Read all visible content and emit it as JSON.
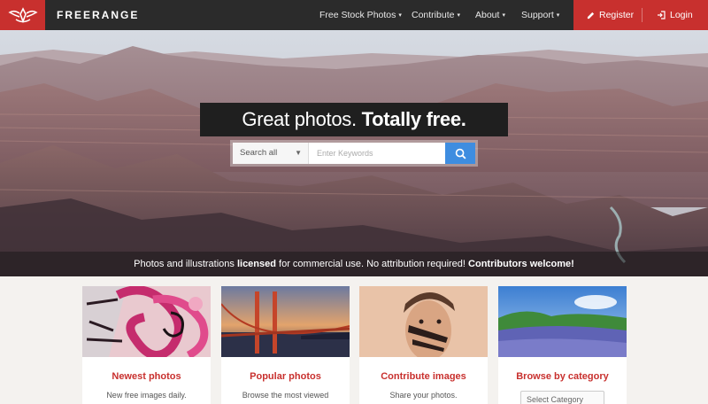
{
  "brand": {
    "name": "FREERANGE",
    "logo_icon": "freerange-logo-icon"
  },
  "nav": {
    "items": [
      {
        "label": "Free Stock Photos"
      },
      {
        "label": "Contribute"
      },
      {
        "label": "About"
      },
      {
        "label": "Support"
      }
    ],
    "caret": "▾"
  },
  "account": {
    "register_label": "Register",
    "login_label": "Login"
  },
  "hero": {
    "headline_regular": "Great photos.",
    "headline_bold": "Totally free.",
    "search": {
      "scope": "Search all",
      "placeholder": "Enter Keywords"
    },
    "tagline": {
      "part1": "Photos and illustrations ",
      "bold1": "licensed",
      "part2": " for commercial use. No attribution required! ",
      "bold2": "Contributors welcome!"
    }
  },
  "cards": [
    {
      "title": "Newest photos",
      "desc": "New free images daily."
    },
    {
      "title": "Popular photos",
      "desc": "Browse the most viewed"
    },
    {
      "title": "Contribute images",
      "desc": "Share your photos."
    },
    {
      "title": "Browse by category",
      "select": "Select Category"
    }
  ],
  "colors": {
    "accent": "#c8302e",
    "topbar": "#2b2b2b",
    "search_button": "#3e8de0"
  }
}
